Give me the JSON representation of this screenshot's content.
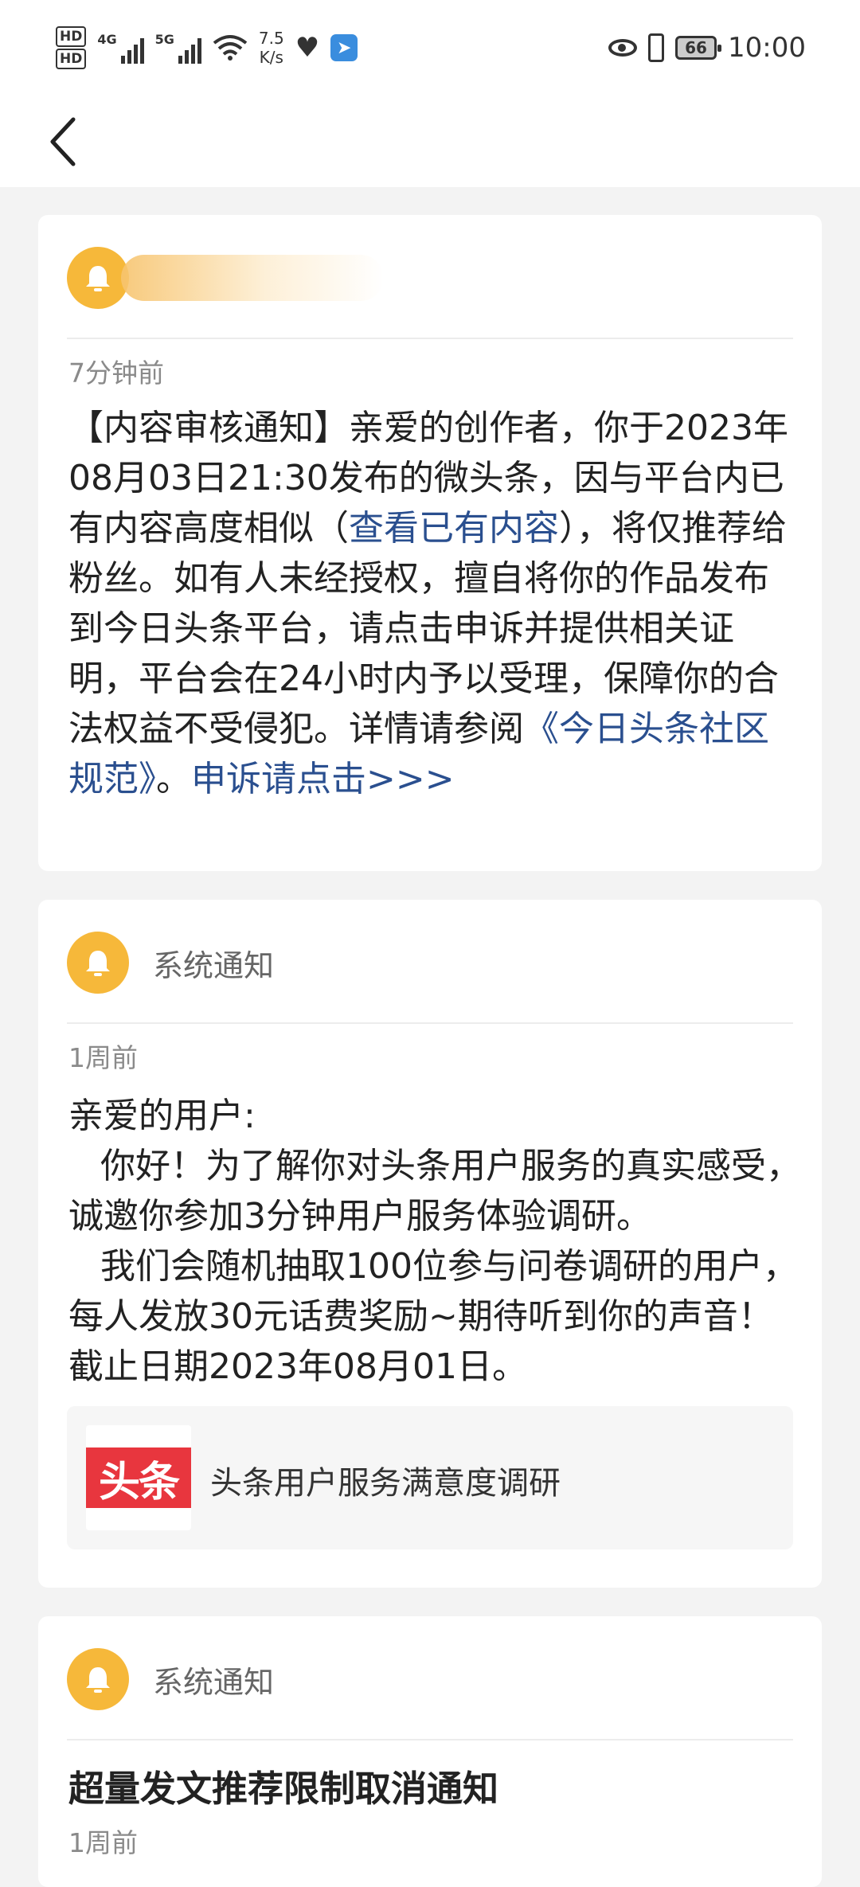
{
  "status_bar": {
    "hd1": "HD",
    "hd2": "HD",
    "sig1_label": "4G",
    "sig2_label": "5G",
    "speed_value": "7.5",
    "speed_unit": "K/s",
    "battery": "66",
    "time": "10:00"
  },
  "notifications": [
    {
      "title": "",
      "time": "7分钟前",
      "body_parts": [
        "【内容审核通知】亲爱的创作者，你于2023年08月03日21:30发布的微头条，因与平台内已有内容高度相似（",
        "查看已有内容",
        "），将仅推荐给粉丝。如有人未经授权，擅自将你的作品发布到今日头条平台，请点击申诉并提供相关证明，平台会在24小时内予以受理，保障你的合法权益不受侵犯。详情请参阅",
        "《今日头条社区规范》",
        "。",
        "申诉请点击>>>"
      ]
    },
    {
      "title": "系统通知",
      "time": "1周前",
      "body_lines": [
        "亲爱的用户:",
        "你好！为了解你对头条用户服务的真实感受，诚邀你参加3分钟用户服务体验调研。",
        "我们会随机抽取100位参与问卷调研的用户，每人发放30元话费奖励~期待听到你的声音！截止日期2023年08月01日。"
      ],
      "attachment": {
        "logo_text": "头条",
        "label": "头条用户服务满意度调研"
      }
    },
    {
      "title": "系统通知",
      "subject": "超量发文推荐限制取消通知",
      "time": "1周前"
    }
  ],
  "colors": {
    "bell": "#f6b83a",
    "link": "#2a4f8f",
    "logo_red": "#e8363e"
  }
}
